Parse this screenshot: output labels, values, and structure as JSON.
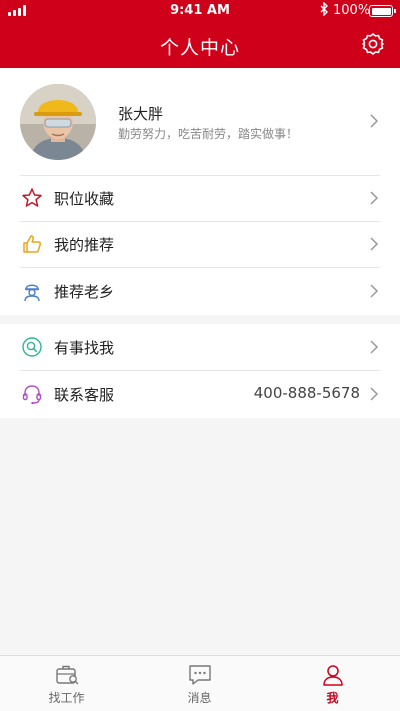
{
  "status_bar": {
    "time": "9:41 AM",
    "battery": "100%"
  },
  "header": {
    "title": "个人中心"
  },
  "profile": {
    "name": "张大胖",
    "motto": "勤劳努力，吃苦耐劳，踏实做事！"
  },
  "menu_group1": [
    {
      "label": "职位收藏",
      "icon": "star-icon"
    },
    {
      "label": "我的推荐",
      "icon": "thumbs-up-icon"
    },
    {
      "label": "推荐老乡",
      "icon": "worker-icon"
    }
  ],
  "menu_group2": [
    {
      "label": "有事找我",
      "icon": "search-icon",
      "value": ""
    },
    {
      "label": "联系客服",
      "icon": "headset-icon",
      "value": "400-888-5678"
    }
  ],
  "tabs": [
    {
      "label": "找工作",
      "icon": "briefcase-icon",
      "active": false
    },
    {
      "label": "消息",
      "icon": "message-icon",
      "active": false
    },
    {
      "label": "我",
      "icon": "user-icon",
      "active": true
    }
  ],
  "colors": {
    "brand": "#cf0019",
    "background": "#f5f5f5"
  }
}
